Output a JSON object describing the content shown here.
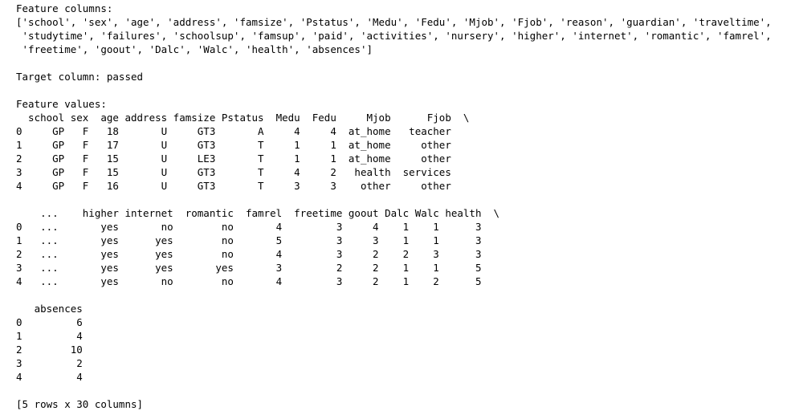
{
  "output": {
    "lines": [
      "Feature columns:",
      "['school', 'sex', 'age', 'address', 'famsize', 'Pstatus', 'Medu', 'Fedu', 'Mjob', 'Fjob', 'reason', 'guardian', 'traveltime',",
      " 'studytime', 'failures', 'schoolsup', 'famsup', 'paid', 'activities', 'nursery', 'higher', 'internet', 'romantic', 'famrel',",
      " 'freetime', 'goout', 'Dalc', 'Walc', 'health', 'absences']",
      "",
      "Target column: passed",
      "",
      "Feature values:",
      "  school sex  age address famsize Pstatus  Medu  Fedu     Mjob      Fjob  \\",
      "0     GP   F   18       U     GT3       A     4     4  at_home   teacher",
      "1     GP   F   17       U     GT3       T     1     1  at_home     other",
      "2     GP   F   15       U     LE3       T     1     1  at_home     other",
      "3     GP   F   15       U     GT3       T     4     2   health  services",
      "4     GP   F   16       U     GT3       T     3     3    other     other",
      "",
      "    ...    higher internet  romantic  famrel  freetime goout Dalc Walc health  \\",
      "0   ...       yes       no        no       4         3     4    1    1      3",
      "1   ...       yes      yes        no       5         3     3    1    1      3",
      "2   ...       yes      yes        no       4         3     2    2    3      3",
      "3   ...       yes      yes       yes       3         2     2    1    1      5",
      "4   ...       yes       no        no       4         3     2    1    2      5",
      "",
      "   absences",
      "0         6",
      "1         4",
      "2        10",
      "3         2",
      "4         4",
      "",
      "[5 rows x 30 columns]"
    ]
  }
}
